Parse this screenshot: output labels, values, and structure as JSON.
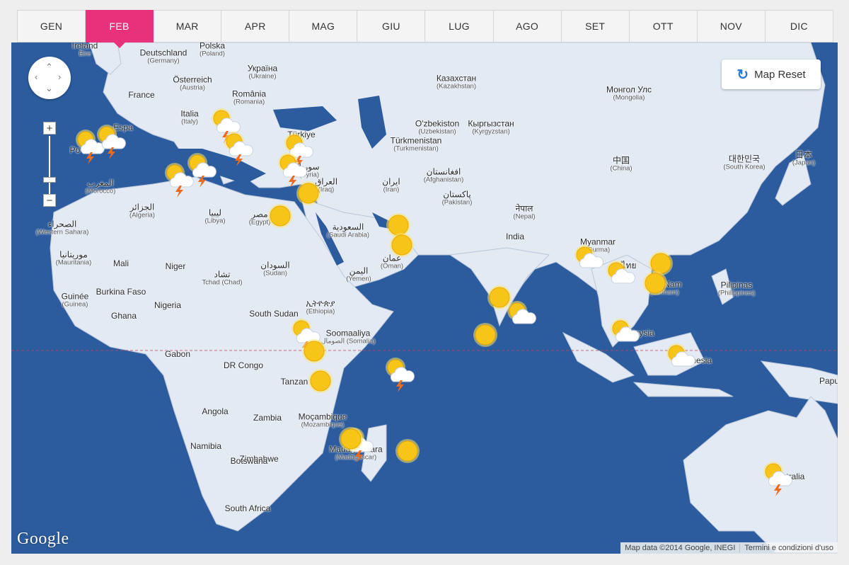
{
  "months": [
    {
      "label": "GEN",
      "active": false
    },
    {
      "label": "FEB",
      "active": true
    },
    {
      "label": "MAR",
      "active": false
    },
    {
      "label": "APR",
      "active": false
    },
    {
      "label": "MAG",
      "active": false
    },
    {
      "label": "GIU",
      "active": false
    },
    {
      "label": "LUG",
      "active": false
    },
    {
      "label": "AGO",
      "active": false
    },
    {
      "label": "SET",
      "active": false
    },
    {
      "label": "OTT",
      "active": false
    },
    {
      "label": "NOV",
      "active": false
    },
    {
      "label": "DIC",
      "active": false
    }
  ],
  "map_reset_label": "Map Reset",
  "google_logo": "Google",
  "attribution": {
    "data": "Map data ©2014 Google, INEGI",
    "terms": "Termini e condizioni d'uso"
  },
  "colors": {
    "accent": "#e8317b",
    "ocean": "#2c5c9e",
    "land": "#e3eaf4",
    "sun": "#f7c518",
    "storm_bolt": "#ee6b1e"
  },
  "places": [
    {
      "name": "Ireland",
      "sub": "Éire"
    },
    {
      "name": "Deutschland",
      "sub": "(Germany)"
    },
    {
      "name": "Polska",
      "sub": "(Poland)"
    },
    {
      "name": "Україна",
      "sub": "(Ukraine)"
    },
    {
      "name": "Österreich",
      "sub": "(Austria)"
    },
    {
      "name": "France",
      "sub": ""
    },
    {
      "name": "România",
      "sub": "(Romania)"
    },
    {
      "name": "Italia",
      "sub": "(Italy)"
    },
    {
      "name": "Espa",
      "sub": ""
    },
    {
      "name": "Po",
      "sub": ""
    },
    {
      "name": "Казахстан",
      "sub": "(Kazakhstan)"
    },
    {
      "name": "Монгол Улс",
      "sub": "(Mongolia)"
    },
    {
      "name": "O'zbekiston",
      "sub": "(Uzbekistan)"
    },
    {
      "name": "Кыргызстан",
      "sub": "(Kyrgyzstan)"
    },
    {
      "name": "Türkmenistan",
      "sub": "(Turkmenistan)"
    },
    {
      "name": "中国",
      "sub": "(China)"
    },
    {
      "name": "대한민국",
      "sub": "(South Korea)"
    },
    {
      "name": "日本",
      "sub": "(Japan)"
    },
    {
      "name": "Türkiye",
      "sub": ""
    },
    {
      "name": "سوريا",
      "sub": "(Syria)"
    },
    {
      "name": "العراق",
      "sub": "(Iraq)"
    },
    {
      "name": "ایران",
      "sub": "(Iran)"
    },
    {
      "name": "افغانستان",
      "sub": "(Afghanistan)"
    },
    {
      "name": "پاکستان",
      "sub": "(Pakistan)"
    },
    {
      "name": "नेपाल",
      "sub": "(Nepal)"
    },
    {
      "name": "India",
      "sub": ""
    },
    {
      "name": "Myanmar",
      "sub": "(Burma)"
    },
    {
      "name": "ไทย",
      "sub": ""
    },
    {
      "name": "Việt Nam",
      "sub": "(Vietnam)"
    },
    {
      "name": "Pilipinas",
      "sub": "(Philippines)"
    },
    {
      "name": "Malaysia",
      "sub": ""
    },
    {
      "name": "Indonesia",
      "sub": ""
    },
    {
      "name": "Papu",
      "sub": ""
    },
    {
      "name": "Australia",
      "sub": ""
    },
    {
      "name": "المغرب",
      "sub": "(Morocco)"
    },
    {
      "name": "الجزائر",
      "sub": "(Algeria)"
    },
    {
      "name": "ليبيا",
      "sub": "(Libya)"
    },
    {
      "name": "مصر",
      "sub": "(Egypt)"
    },
    {
      "name": "الصحراء",
      "sub": "(Western Sahara)"
    },
    {
      "name": "موريتانيا",
      "sub": "(Mauritania)"
    },
    {
      "name": "Mali",
      "sub": ""
    },
    {
      "name": "Niger",
      "sub": ""
    },
    {
      "name": "تشاد",
      "sub": "Tchad (Chad)"
    },
    {
      "name": "السودان",
      "sub": "(Sudan)"
    },
    {
      "name": "السعودية",
      "sub": "(Saudi Arabia)"
    },
    {
      "name": "عمان",
      "sub": "(Oman)"
    },
    {
      "name": "اليمن",
      "sub": "(Yemen)"
    },
    {
      "name": "Burkina Faso",
      "sub": ""
    },
    {
      "name": "Guinée",
      "sub": "(Guinea)"
    },
    {
      "name": "Ghana",
      "sub": ""
    },
    {
      "name": "Nigeria",
      "sub": ""
    },
    {
      "name": "South Sudan",
      "sub": ""
    },
    {
      "name": "ኢትዮጵያ",
      "sub": "(Ethiopia)"
    },
    {
      "name": "Soomaaliya",
      "sub": "الصومال (Somalia)"
    },
    {
      "name": "Gabon",
      "sub": ""
    },
    {
      "name": "DR Congo",
      "sub": ""
    },
    {
      "name": "Tanzan",
      "sub": ""
    },
    {
      "name": "Angola",
      "sub": ""
    },
    {
      "name": "Zambia",
      "sub": ""
    },
    {
      "name": "Moçambique",
      "sub": "(Mozambique)"
    },
    {
      "name": "Namibia",
      "sub": ""
    },
    {
      "name": "Zimbabwe",
      "sub": ""
    },
    {
      "name": "Botswana",
      "sub": ""
    },
    {
      "name": "Madagasikara",
      "sub": "(Madagascar)"
    },
    {
      "name": "South Africa",
      "sub": ""
    }
  ],
  "weather_markers": [
    {
      "kind": "storm"
    },
    {
      "kind": "storm"
    },
    {
      "kind": "storm"
    },
    {
      "kind": "storm"
    },
    {
      "kind": "storm"
    },
    {
      "kind": "storm"
    },
    {
      "kind": "storm"
    },
    {
      "kind": "storm"
    },
    {
      "kind": "storm"
    },
    {
      "kind": "sun"
    },
    {
      "kind": "sun"
    },
    {
      "kind": "sun"
    },
    {
      "kind": "sun"
    },
    {
      "kind": "sun"
    },
    {
      "kind": "partly-cloudy"
    },
    {
      "kind": "sun"
    },
    {
      "kind": "sun"
    },
    {
      "kind": "sun"
    },
    {
      "kind": "storm"
    },
    {
      "kind": "storm"
    },
    {
      "kind": "sun"
    },
    {
      "kind": "sun"
    },
    {
      "kind": "partly-cloudy"
    },
    {
      "kind": "partly-cloudy"
    },
    {
      "kind": "sun"
    },
    {
      "kind": "sun"
    },
    {
      "kind": "partly-cloudy"
    },
    {
      "kind": "partly-cloudy"
    },
    {
      "kind": "storm"
    }
  ]
}
